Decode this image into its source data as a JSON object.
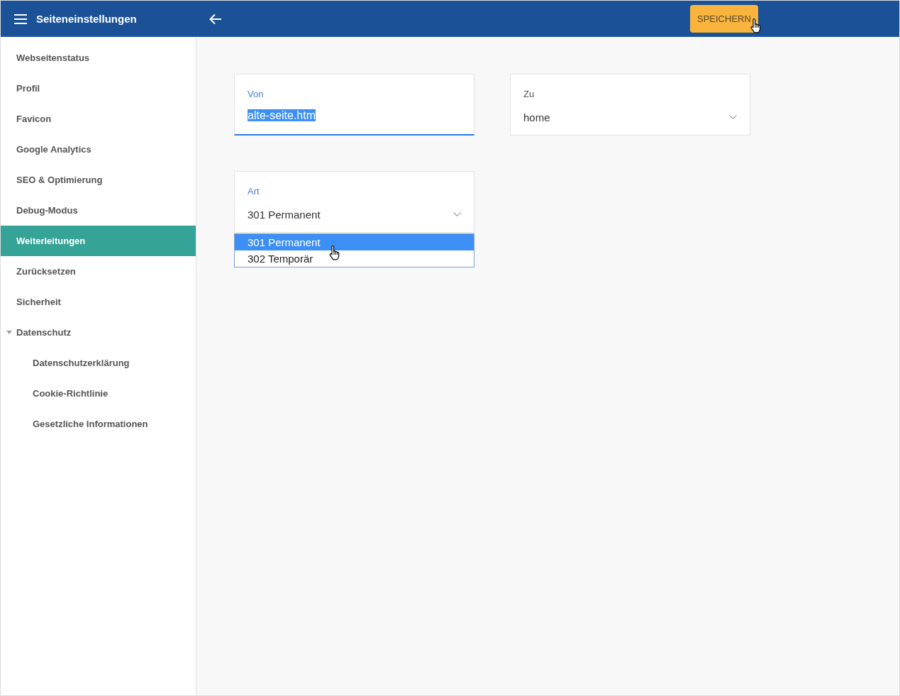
{
  "header": {
    "title": "Seiteneinstellungen",
    "save_button": "SPEICHERN"
  },
  "sidebar": {
    "items": [
      {
        "label": "Webseitenstatus",
        "selected": false
      },
      {
        "label": "Profil",
        "selected": false
      },
      {
        "label": "Favicon",
        "selected": false
      },
      {
        "label": "Google Analytics",
        "selected": false
      },
      {
        "label": "SEO & Optimierung",
        "selected": false
      },
      {
        "label": "Debug-Modus",
        "selected": false
      },
      {
        "label": "Weiterleitungen",
        "selected": true
      },
      {
        "label": "Zurücksetzen",
        "selected": false
      },
      {
        "label": "Sicherheit",
        "selected": false
      },
      {
        "label": "Datenschutz",
        "selected": false,
        "expanded": true,
        "children": [
          {
            "label": "Datenschutzerklärung",
            "selected": false
          },
          {
            "label": "Cookie-Richtlinie",
            "selected": false
          },
          {
            "label": "Gesetzliche Informationen",
            "selected": false
          }
        ]
      }
    ]
  },
  "form": {
    "rows": [
      {
        "fields": [
          {
            "kind": "text",
            "label": "Von",
            "value": "alte-seite.htm",
            "focused": true,
            "text_selected": true
          },
          {
            "kind": "select",
            "label": "Zu",
            "value": "home",
            "focused": false
          }
        ]
      },
      {
        "fields": [
          {
            "kind": "select",
            "label": "Art",
            "value": "301 Permanent",
            "focused": true,
            "options": [
              {
                "label": "301 Permanent",
                "selected": true
              },
              {
                "label": "302 Temporär",
                "selected": false
              }
            ]
          }
        ]
      }
    ]
  }
}
